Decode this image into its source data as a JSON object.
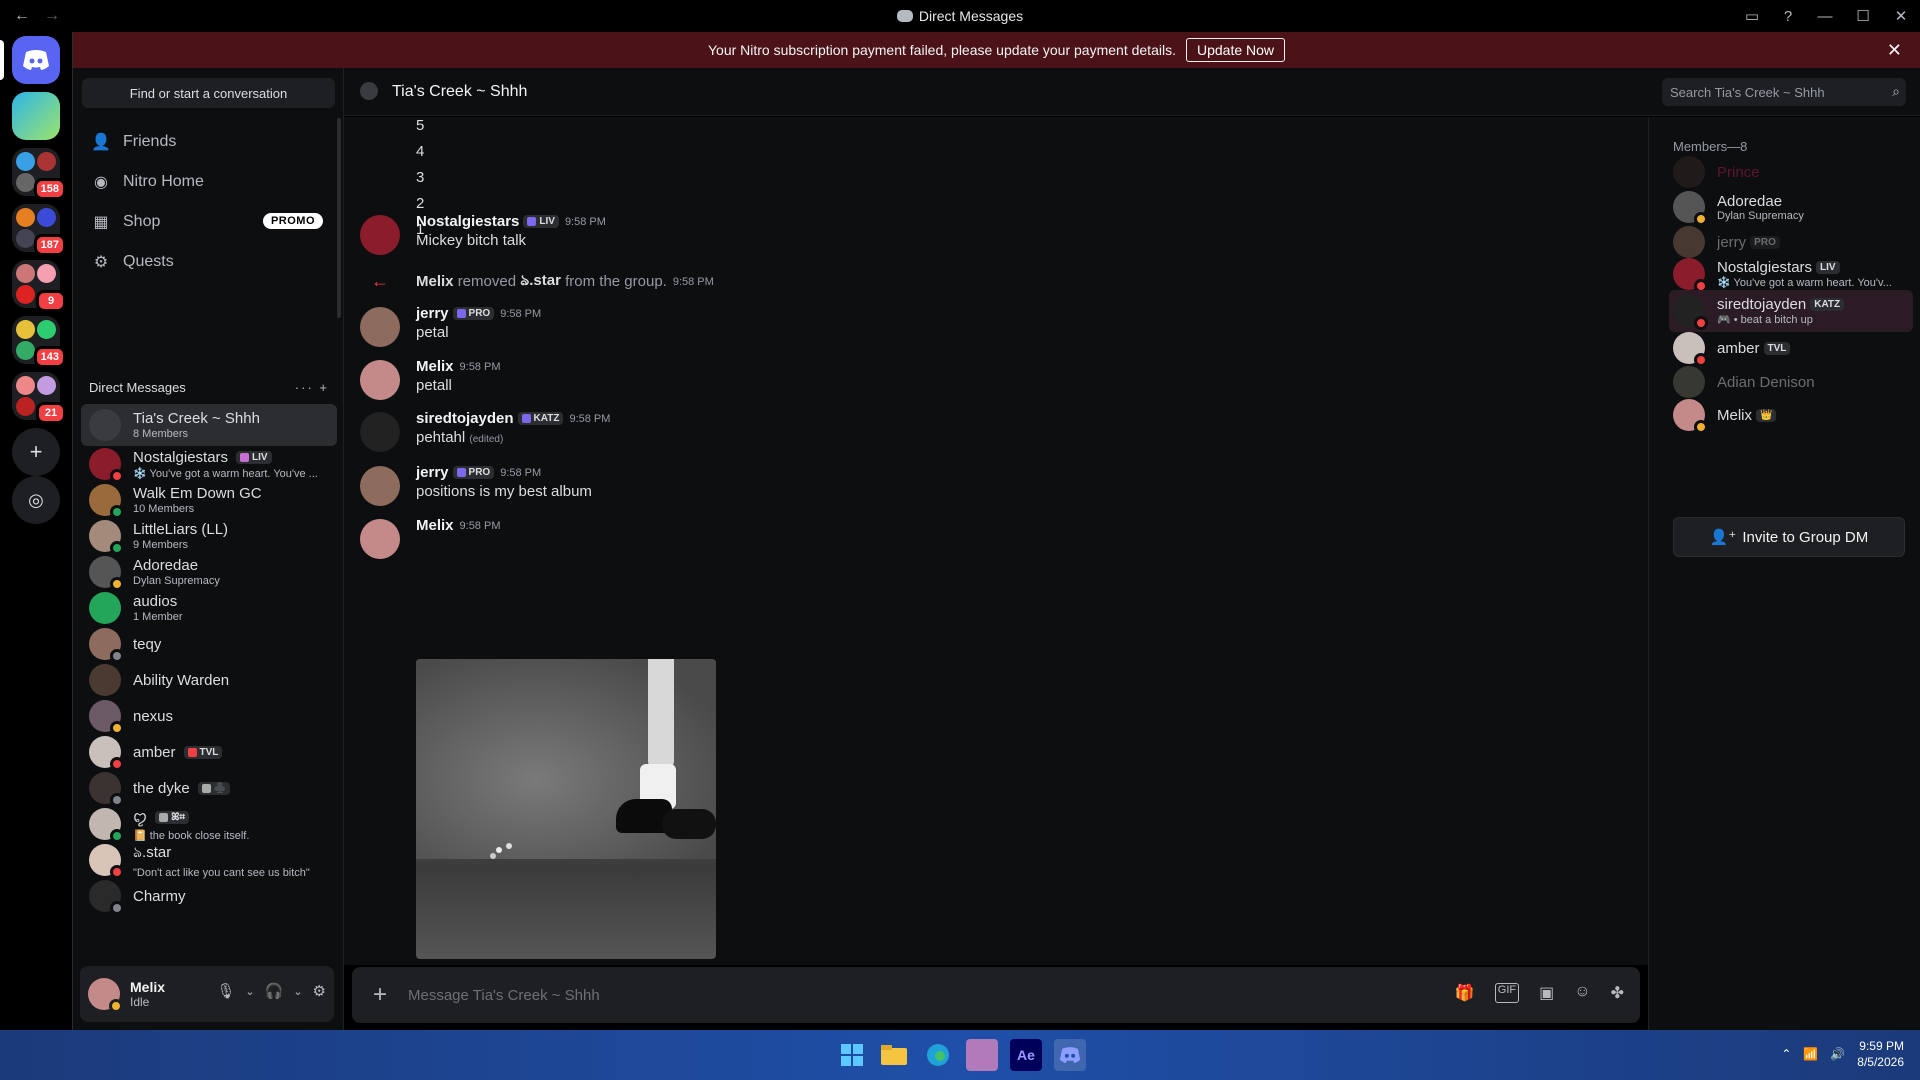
{
  "window": {
    "title": "Direct Messages"
  },
  "banner": {
    "text": "Your Nitro subscription payment failed, please update your payment details.",
    "button": "Update Now"
  },
  "rail": {
    "badges": [
      "158",
      "187",
      "9",
      "143",
      "21"
    ]
  },
  "sidebar": {
    "find_placeholder": "Find or start a conversation",
    "nav": [
      {
        "label": "Friends",
        "icon": "friends-icon"
      },
      {
        "label": "Nitro Home",
        "icon": "nitro-icon"
      },
      {
        "label": "Shop",
        "icon": "shop-icon",
        "badge": "PROMO"
      },
      {
        "label": "Quests",
        "icon": "quests-icon"
      }
    ],
    "dm_header": "Direct Messages",
    "dms": [
      {
        "name": "Tia's Creek ~ Shhh",
        "sub": "8 Members",
        "selected": true,
        "color": "#3a3b40"
      },
      {
        "name": "Nostalgiestars",
        "sub": "❄️ You've got a warm heart. You've ...",
        "tag": "LIV",
        "tagcolor": "#c76fd6",
        "status": "dnd",
        "color": "#8a1c2b"
      },
      {
        "name": "Walk Em Down GC",
        "sub": "10 Members",
        "status": "online",
        "color": "#9a6a3c"
      },
      {
        "name": "LittleLiars (LL)",
        "sub": "9 Members",
        "status": "online",
        "color": "#a38a7a"
      },
      {
        "name": "Adoredae",
        "sub": "Dylan Supremacy",
        "status": "idle",
        "color": "#555"
      },
      {
        "name": "audios",
        "sub": "1 Member",
        "color": "#23a55a"
      },
      {
        "name": "teqy",
        "status": "off",
        "color": "#8d6b5d"
      },
      {
        "name": "Ability Warden",
        "color": "#4a3a30"
      },
      {
        "name": "nexus",
        "status": "idle",
        "color": "#6b5a66"
      },
      {
        "name": "amber",
        "tag": "TVL",
        "tagcolor": "#f23f43",
        "status": "dnd",
        "color": "#c9c0bc"
      },
      {
        "name": "the dyke",
        "tag": "♣️",
        "tagcolor": "#aaa",
        "status": "off",
        "color": "#3b3332"
      },
      {
        "name": "ꨄ︎",
        "sub": "📔 the book close itself.",
        "tag": "ꕤ⌗",
        "tagcolor": "#aaa",
        "status": "online",
        "color": "#c2b7b0"
      },
      {
        "name": "ঌ.star",
        "sub": "\"Don't act like you cant see us bitch\"",
        "status": "dnd",
        "color": "#d9c5b8"
      },
      {
        "name": "Charmy",
        "status": "off",
        "color": "#2a2a2a"
      }
    ]
  },
  "user": {
    "name": "Melix",
    "status": "Idle"
  },
  "chat": {
    "channel": "Tia's Creek ~ Shhh",
    "search_placeholder": "Search Tia's Creek ~ Shhh",
    "countdown": [
      "5",
      "4",
      "3",
      "2",
      "1"
    ],
    "messages": [
      {
        "author": "Nostalgiestars",
        "tag": "LIV",
        "time": "9:58 PM",
        "body": "Mickey bitch talk",
        "color": "#8a1c2b"
      },
      {
        "system": true,
        "actor": "Melix",
        "verb": "removed",
        "target": "ঌ.star",
        "rest": "from the group.",
        "time": "9:58 PM"
      },
      {
        "author": "jerry",
        "tag": "PRO",
        "time": "9:58 PM",
        "body": "petal",
        "color": "#8d6b5d"
      },
      {
        "author": "Melix",
        "time": "9:58 PM",
        "body": "petall",
        "color": "#c48a8a"
      },
      {
        "author": "siredtojayden",
        "tag": "KATZ",
        "time": "9:58 PM",
        "body": "pehtahl",
        "edited": "(edited)",
        "color": "#222"
      },
      {
        "author": "jerry",
        "tag": "PRO",
        "time": "9:58 PM",
        "body": "positions is my best album",
        "color": "#8d6b5d"
      },
      {
        "author": "Melix",
        "time": "9:58 PM",
        "body": "",
        "color": "#c48a8a"
      }
    ],
    "composer_placeholder": "Message Tia's Creek ~ Shhh"
  },
  "members": {
    "header": "Members—8",
    "list": [
      {
        "name": "Prince",
        "offline": true,
        "namecolor": "#c2185b",
        "color": "#3a2a2a"
      },
      {
        "name": "Adoredae",
        "sub": "Dylan Supremacy",
        "status": "idle",
        "color": "#555"
      },
      {
        "name": "jerry",
        "tag": "PRO",
        "offline": true,
        "color": "#8d6b5d"
      },
      {
        "name": "Nostalgiestars",
        "tag": "LIV",
        "sub": "❄️ You've got a warm heart. You'v...",
        "status": "dnd",
        "color": "#8a1c2b"
      },
      {
        "name": "siredtojayden",
        "tag": "KATZ",
        "sub": "🎮 • beat a bitch up",
        "status": "dnd",
        "color": "#222",
        "highlight": true
      },
      {
        "name": "amber",
        "tag": "TVL",
        "status": "dnd",
        "color": "#c9c0bc"
      },
      {
        "name": "Adian Denison",
        "offline": true,
        "color": "#6b6b5a"
      },
      {
        "name": "Melix",
        "tag": "👑",
        "status": "idle",
        "color": "#c48a8a"
      }
    ],
    "invite": "Invite to Group DM"
  },
  "taskbar": {
    "time": "9:59 PM",
    "date": "8/5/2026"
  }
}
